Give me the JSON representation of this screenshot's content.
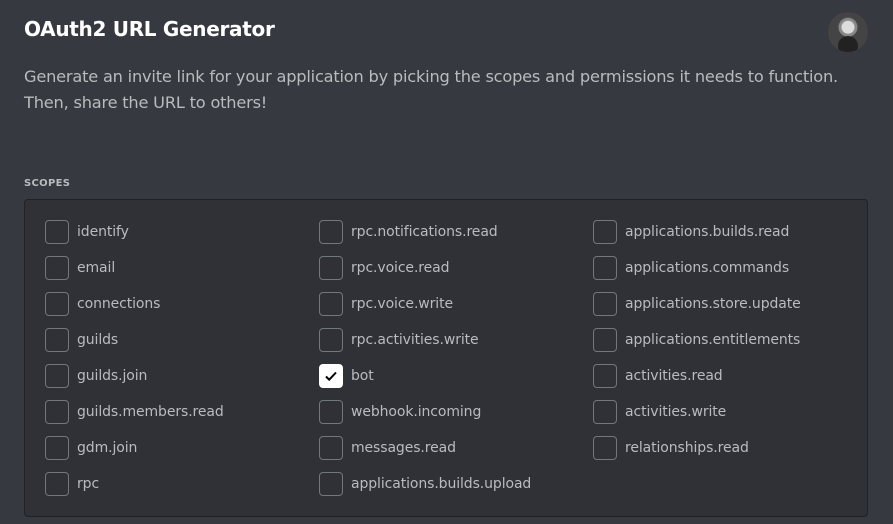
{
  "header": {
    "title": "OAuth2 URL Generator",
    "description": "Generate an invite link for your application by picking the scopes and permissions it needs to function. Then, share the URL to others!"
  },
  "scopes": {
    "label": "SCOPES",
    "columns": [
      [
        {
          "label": "identify",
          "checked": false
        },
        {
          "label": "email",
          "checked": false
        },
        {
          "label": "connections",
          "checked": false
        },
        {
          "label": "guilds",
          "checked": false
        },
        {
          "label": "guilds.join",
          "checked": false
        },
        {
          "label": "guilds.members.read",
          "checked": false
        },
        {
          "label": "gdm.join",
          "checked": false
        },
        {
          "label": "rpc",
          "checked": false
        }
      ],
      [
        {
          "label": "rpc.notifications.read",
          "checked": false
        },
        {
          "label": "rpc.voice.read",
          "checked": false
        },
        {
          "label": "rpc.voice.write",
          "checked": false
        },
        {
          "label": "rpc.activities.write",
          "checked": false
        },
        {
          "label": "bot",
          "checked": true
        },
        {
          "label": "webhook.incoming",
          "checked": false
        },
        {
          "label": "messages.read",
          "checked": false
        },
        {
          "label": "applications.builds.upload",
          "checked": false
        }
      ],
      [
        {
          "label": "applications.builds.read",
          "checked": false
        },
        {
          "label": "applications.commands",
          "checked": false
        },
        {
          "label": "applications.store.update",
          "checked": false
        },
        {
          "label": "applications.entitlements",
          "checked": false
        },
        {
          "label": "activities.read",
          "checked": false
        },
        {
          "label": "activities.write",
          "checked": false
        },
        {
          "label": "relationships.read",
          "checked": false
        }
      ]
    ]
  }
}
